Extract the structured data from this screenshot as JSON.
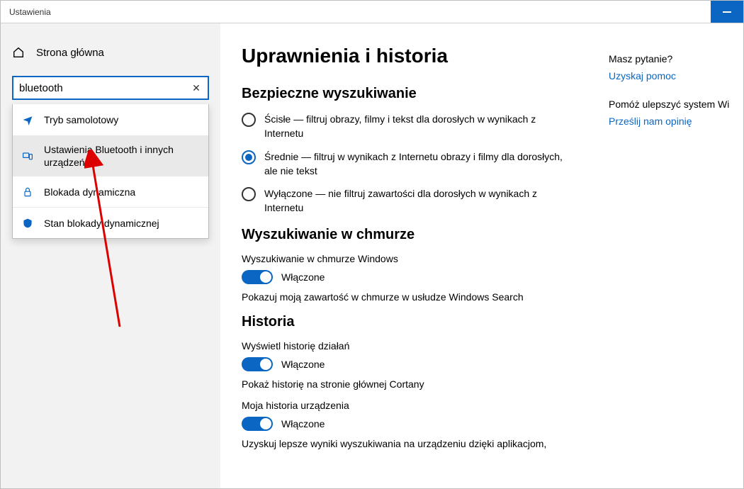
{
  "window": {
    "title": "Ustawienia"
  },
  "sidebar": {
    "home": "Strona główna",
    "search_value": "bluetooth",
    "suggestions": [
      {
        "icon": "airplane-icon",
        "label": "Tryb samolotowy"
      },
      {
        "icon": "devices-icon",
        "label": "Ustawienia Bluetooth i innych urządzeń"
      },
      {
        "icon": "lock-icon",
        "label": "Blokada dynamiczna"
      },
      {
        "icon": "shield-icon",
        "label": "Stan blokady dynamicznej"
      }
    ]
  },
  "main": {
    "title": "Uprawnienia i historia",
    "safe_search": {
      "heading": "Bezpieczne wyszukiwanie",
      "options": [
        {
          "label": "Ścisłe — filtruj obrazy, filmy i tekst dla dorosłych w wynikach z Internetu",
          "selected": false
        },
        {
          "label": "Średnie — filtruj w wynikach z Internetu obrazy i filmy dla dorosłych, ale nie tekst",
          "selected": true
        },
        {
          "label": "Wyłączone — nie filtruj zawartości dla dorosłych w wynikach z Internetu",
          "selected": false
        }
      ]
    },
    "cloud": {
      "heading": "Wyszukiwanie w chmurze",
      "label": "Wyszukiwanie w chmurze Windows",
      "state": "Włączone",
      "desc": "Pokazuj moją zawartość w chmurze w usłudze Windows Search"
    },
    "history": {
      "heading": "Historia",
      "activity_label": "Wyświetl historię działań",
      "activity_state": "Włączone",
      "activity_desc": "Pokaż historię na stronie głównej Cortany",
      "device_label": "Moja historia urządzenia",
      "device_state": "Włączone",
      "device_desc": "Uzyskuj lepsze wyniki wyszukiwania na urządzeniu dzięki aplikacjom,"
    }
  },
  "help": {
    "question": "Masz pytanie?",
    "get_help": "Uzyskaj pomoc",
    "improve": "Pomóż ulepszyć system Wi",
    "feedback": "Prześlij nam opinię"
  }
}
